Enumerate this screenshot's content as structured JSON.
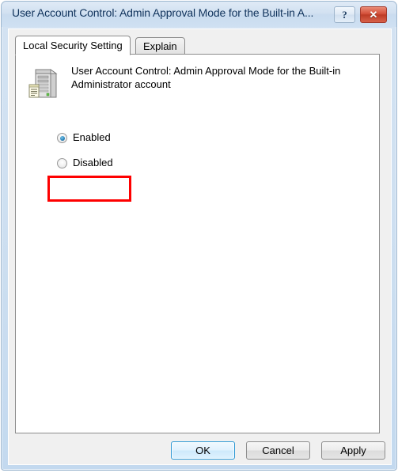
{
  "window": {
    "title": "User Account Control: Admin Approval Mode for the Built-in A...",
    "help_button": {
      "name": "help-button",
      "glyph": "?"
    },
    "close_button": {
      "name": "close-button",
      "glyph": "✕"
    }
  },
  "tabs": [
    {
      "label": "Local Security Setting",
      "active": true
    },
    {
      "label": "Explain",
      "active": false
    }
  ],
  "setting": {
    "icon": "server-policy-icon",
    "description": "User Account Control: Admin Approval Mode for the Built-in Administrator account"
  },
  "options": [
    {
      "label": "Enabled",
      "selected": true
    },
    {
      "label": "Disabled",
      "selected": false
    }
  ],
  "annotation": {
    "type": "highlight-rectangle",
    "target": "Enabled",
    "color": "#fe0000"
  },
  "buttons": [
    {
      "label": "OK",
      "style": "default"
    },
    {
      "label": "Cancel",
      "style": "normal"
    },
    {
      "label": "Apply",
      "style": "normal"
    }
  ],
  "colors": {
    "titlebar": "#cfe0f1",
    "frame_border": "#9cb6cf",
    "client_background": "#f0f0f0",
    "page_background": "#ffffff",
    "close_button": "#c3422c",
    "default_button_border": "#2c98d4",
    "annotation": "#fe0000",
    "radio_dot": "#2d86bd"
  }
}
